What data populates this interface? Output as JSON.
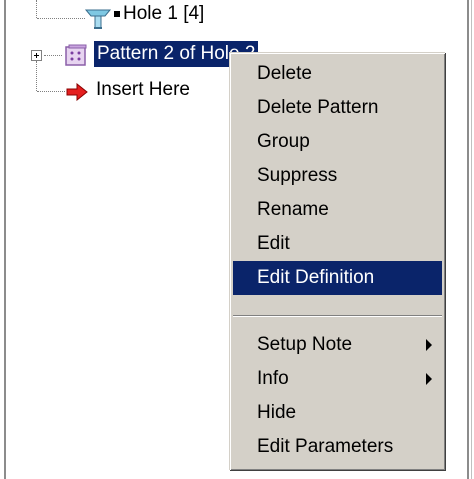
{
  "tree": {
    "items": [
      {
        "label": "Hole 1 [4]",
        "icon": "hole-feature-icon"
      },
      {
        "label": "Pattern 2 of Hole 2",
        "icon": "pattern-feature-icon",
        "selected": true
      },
      {
        "label": "Insert Here",
        "icon": "insert-here-arrow-icon"
      }
    ]
  },
  "context_menu": {
    "items": [
      {
        "label": "Delete"
      },
      {
        "label": "Delete Pattern"
      },
      {
        "label": "Group"
      },
      {
        "label": "Suppress"
      },
      {
        "label": "Rename"
      },
      {
        "label": "Edit"
      },
      {
        "label": "Edit Definition",
        "highlighted": true
      },
      {
        "label": "Setup Note",
        "submenu": true
      },
      {
        "label": "Info",
        "submenu": true
      },
      {
        "label": "Hide"
      },
      {
        "label": "Edit Parameters"
      }
    ]
  },
  "colors": {
    "selection": "#0a246a",
    "menu_background": "#d4d0c8"
  }
}
